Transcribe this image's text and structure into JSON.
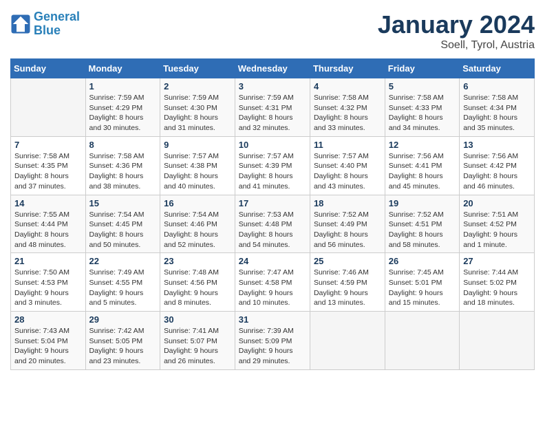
{
  "header": {
    "logo_line1": "General",
    "logo_line2": "Blue",
    "title": "January 2024",
    "subtitle": "Soell, Tyrol, Austria"
  },
  "weekdays": [
    "Sunday",
    "Monday",
    "Tuesday",
    "Wednesday",
    "Thursday",
    "Friday",
    "Saturday"
  ],
  "rows": [
    [
      {
        "num": "",
        "info": ""
      },
      {
        "num": "1",
        "info": "Sunrise: 7:59 AM\nSunset: 4:29 PM\nDaylight: 8 hours\nand 30 minutes."
      },
      {
        "num": "2",
        "info": "Sunrise: 7:59 AM\nSunset: 4:30 PM\nDaylight: 8 hours\nand 31 minutes."
      },
      {
        "num": "3",
        "info": "Sunrise: 7:59 AM\nSunset: 4:31 PM\nDaylight: 8 hours\nand 32 minutes."
      },
      {
        "num": "4",
        "info": "Sunrise: 7:58 AM\nSunset: 4:32 PM\nDaylight: 8 hours\nand 33 minutes."
      },
      {
        "num": "5",
        "info": "Sunrise: 7:58 AM\nSunset: 4:33 PM\nDaylight: 8 hours\nand 34 minutes."
      },
      {
        "num": "6",
        "info": "Sunrise: 7:58 AM\nSunset: 4:34 PM\nDaylight: 8 hours\nand 35 minutes."
      }
    ],
    [
      {
        "num": "7",
        "info": "Sunrise: 7:58 AM\nSunset: 4:35 PM\nDaylight: 8 hours\nand 37 minutes."
      },
      {
        "num": "8",
        "info": "Sunrise: 7:58 AM\nSunset: 4:36 PM\nDaylight: 8 hours\nand 38 minutes."
      },
      {
        "num": "9",
        "info": "Sunrise: 7:57 AM\nSunset: 4:38 PM\nDaylight: 8 hours\nand 40 minutes."
      },
      {
        "num": "10",
        "info": "Sunrise: 7:57 AM\nSunset: 4:39 PM\nDaylight: 8 hours\nand 41 minutes."
      },
      {
        "num": "11",
        "info": "Sunrise: 7:57 AM\nSunset: 4:40 PM\nDaylight: 8 hours\nand 43 minutes."
      },
      {
        "num": "12",
        "info": "Sunrise: 7:56 AM\nSunset: 4:41 PM\nDaylight: 8 hours\nand 45 minutes."
      },
      {
        "num": "13",
        "info": "Sunrise: 7:56 AM\nSunset: 4:42 PM\nDaylight: 8 hours\nand 46 minutes."
      }
    ],
    [
      {
        "num": "14",
        "info": "Sunrise: 7:55 AM\nSunset: 4:44 PM\nDaylight: 8 hours\nand 48 minutes."
      },
      {
        "num": "15",
        "info": "Sunrise: 7:54 AM\nSunset: 4:45 PM\nDaylight: 8 hours\nand 50 minutes."
      },
      {
        "num": "16",
        "info": "Sunrise: 7:54 AM\nSunset: 4:46 PM\nDaylight: 8 hours\nand 52 minutes."
      },
      {
        "num": "17",
        "info": "Sunrise: 7:53 AM\nSunset: 4:48 PM\nDaylight: 8 hours\nand 54 minutes."
      },
      {
        "num": "18",
        "info": "Sunrise: 7:52 AM\nSunset: 4:49 PM\nDaylight: 8 hours\nand 56 minutes."
      },
      {
        "num": "19",
        "info": "Sunrise: 7:52 AM\nSunset: 4:51 PM\nDaylight: 8 hours\nand 58 minutes."
      },
      {
        "num": "20",
        "info": "Sunrise: 7:51 AM\nSunset: 4:52 PM\nDaylight: 9 hours\nand 1 minute."
      }
    ],
    [
      {
        "num": "21",
        "info": "Sunrise: 7:50 AM\nSunset: 4:53 PM\nDaylight: 9 hours\nand 3 minutes."
      },
      {
        "num": "22",
        "info": "Sunrise: 7:49 AM\nSunset: 4:55 PM\nDaylight: 9 hours\nand 5 minutes."
      },
      {
        "num": "23",
        "info": "Sunrise: 7:48 AM\nSunset: 4:56 PM\nDaylight: 9 hours\nand 8 minutes."
      },
      {
        "num": "24",
        "info": "Sunrise: 7:47 AM\nSunset: 4:58 PM\nDaylight: 9 hours\nand 10 minutes."
      },
      {
        "num": "25",
        "info": "Sunrise: 7:46 AM\nSunset: 4:59 PM\nDaylight: 9 hours\nand 13 minutes."
      },
      {
        "num": "26",
        "info": "Sunrise: 7:45 AM\nSunset: 5:01 PM\nDaylight: 9 hours\nand 15 minutes."
      },
      {
        "num": "27",
        "info": "Sunrise: 7:44 AM\nSunset: 5:02 PM\nDaylight: 9 hours\nand 18 minutes."
      }
    ],
    [
      {
        "num": "28",
        "info": "Sunrise: 7:43 AM\nSunset: 5:04 PM\nDaylight: 9 hours\nand 20 minutes."
      },
      {
        "num": "29",
        "info": "Sunrise: 7:42 AM\nSunset: 5:05 PM\nDaylight: 9 hours\nand 23 minutes."
      },
      {
        "num": "30",
        "info": "Sunrise: 7:41 AM\nSunset: 5:07 PM\nDaylight: 9 hours\nand 26 minutes."
      },
      {
        "num": "31",
        "info": "Sunrise: 7:39 AM\nSunset: 5:09 PM\nDaylight: 9 hours\nand 29 minutes."
      },
      {
        "num": "",
        "info": ""
      },
      {
        "num": "",
        "info": ""
      },
      {
        "num": "",
        "info": ""
      }
    ]
  ]
}
